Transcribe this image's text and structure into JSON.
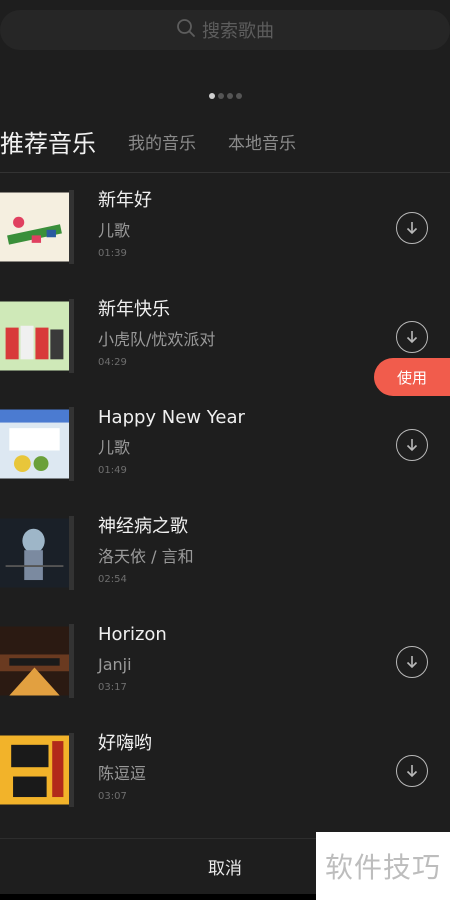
{
  "search": {
    "placeholder": "搜索歌曲",
    "icon": "search-icon"
  },
  "pager": {
    "dots": 4,
    "active_index": 0
  },
  "tabs": [
    {
      "label": "推荐音乐",
      "active": true
    },
    {
      "label": "我的音乐",
      "active": false
    },
    {
      "label": "本地音乐",
      "active": false
    }
  ],
  "songs": [
    {
      "title": "新年好",
      "artist": "儿歌",
      "duration": "01:39",
      "action": "download-icon",
      "cover_colors": [
        "#f5efe0",
        "#3a8f3a",
        "#e04060"
      ]
    },
    {
      "title": "新年快乐",
      "artist": "小虎队/忧欢派对",
      "duration": "04:29",
      "action": "download-icon",
      "cover_colors": [
        "#cfe9b8",
        "#d83a3a",
        "#f0f0f0"
      ]
    },
    {
      "title": "Happy New Year",
      "artist": "儿歌",
      "duration": "01:49",
      "action": "download-icon",
      "cover_colors": [
        "#dde8f2",
        "#4b7bd1",
        "#e8c63a"
      ]
    },
    {
      "title": "神经病之歌",
      "artist": "洛天依 / 言和",
      "duration": "02:54",
      "action": "use",
      "cover_colors": [
        "#1a2028",
        "#9eb6c8",
        "#555"
      ]
    },
    {
      "title": "Horizon",
      "artist": "Janji",
      "duration": "03:17",
      "action": "download-icon",
      "cover_colors": [
        "#2b1a12",
        "#e2a040",
        "#6a3a20"
      ]
    },
    {
      "title": "好嗨哟",
      "artist": "陈逗逗",
      "duration": "03:07",
      "action": "download-icon",
      "cover_colors": [
        "#f2b32a",
        "#1a1a1a",
        "#b22a1a"
      ]
    }
  ],
  "use_button": {
    "label": "使用"
  },
  "bottom": {
    "cancel_label": "取消"
  },
  "watermark": {
    "text": "软件技巧"
  },
  "colors": {
    "accent": "#f15c4c",
    "background": "#1e1e1e"
  }
}
